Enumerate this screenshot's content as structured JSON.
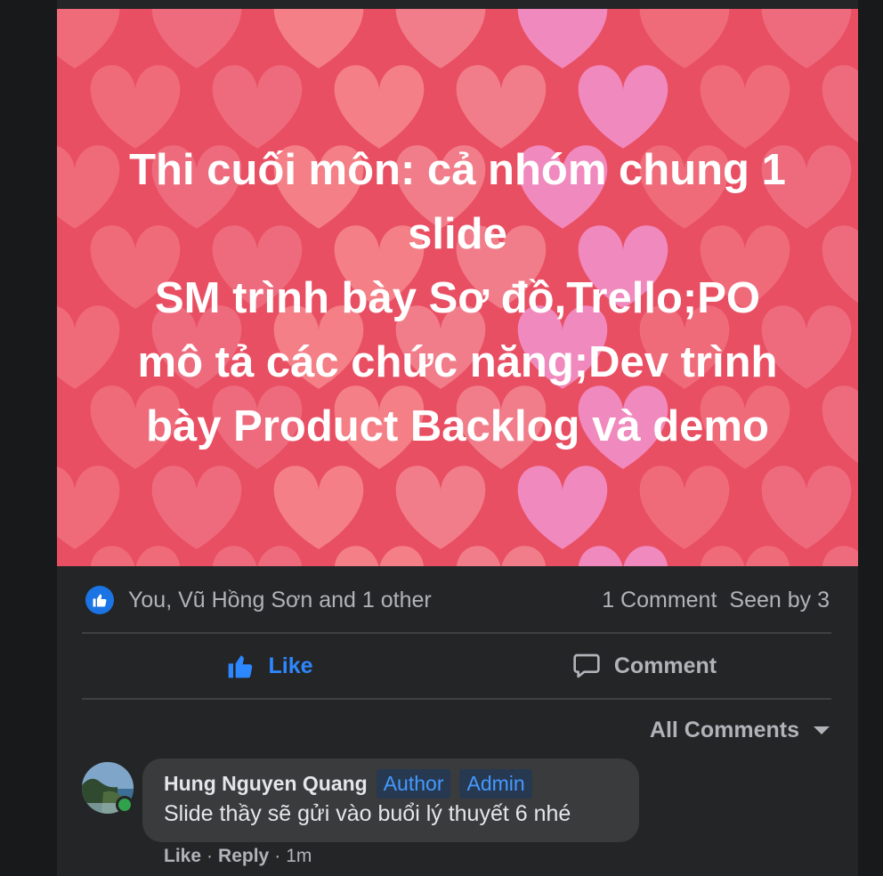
{
  "post": {
    "lines": [
      "Thi cuối môn: cả nhóm chung 1",
      "slide",
      "SM trình bày Sơ đồ,Trello;PO",
      "mô tả các chức năng;Dev trình",
      "bày Product Backlog và demo"
    ],
    "background_color": "#e94f63"
  },
  "reactions": {
    "summary": "You, Vũ Hồng Sơn and 1 other",
    "comments_count": "1 Comment",
    "seen_by": "Seen by 3",
    "icon": "like-icon"
  },
  "actions": {
    "like_label": "Like",
    "comment_label": "Comment",
    "like_color": "#2d88ff"
  },
  "comments_filter": {
    "label": "All Comments",
    "icon": "caret-down-icon"
  },
  "comment": {
    "author": "Hung Nguyen Quang",
    "badges": [
      "Author",
      "Admin"
    ],
    "text": "Slide thầy sẽ gửi vào buổi lý thuyết 6 nhé",
    "like_label": "Like",
    "reply_label": "Reply",
    "time": "1m"
  }
}
